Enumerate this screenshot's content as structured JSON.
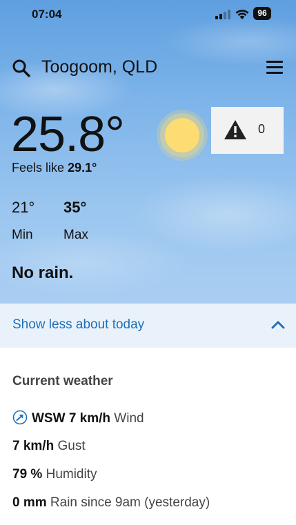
{
  "status_bar": {
    "time": "07:04",
    "battery": "96"
  },
  "header": {
    "location": "Toogoom, QLD"
  },
  "today": {
    "temperature": "25.8°",
    "feels_like_label": "Feels like",
    "feels_like_value": "29.1°",
    "min_value": "21°",
    "min_label": "Min",
    "max_value": "35°",
    "max_label": "Max",
    "rain_summary": "No rain.",
    "warning_count": "0"
  },
  "expand": {
    "label": "Show less about today"
  },
  "current_weather": {
    "title": "Current weather",
    "wind_value": "WSW 7 km/h",
    "wind_label": "Wind",
    "gust_value": "7 km/h",
    "gust_label": "Gust",
    "humidity_value": "79 %",
    "humidity_label": "Humidity",
    "rain_value": "0 mm",
    "rain_label": "Rain since 9am (yesterday)"
  },
  "icons": {
    "search": "search-icon",
    "menu": "menu-icon",
    "sun": "sun-icon",
    "warning": "warning-icon",
    "chevron": "chevron-up-icon",
    "wind_direction": "wind-direction-icon"
  },
  "colors": {
    "accent": "#1f6fb8",
    "expand_bg": "#e9f2fb",
    "sun": "#fddc73"
  }
}
